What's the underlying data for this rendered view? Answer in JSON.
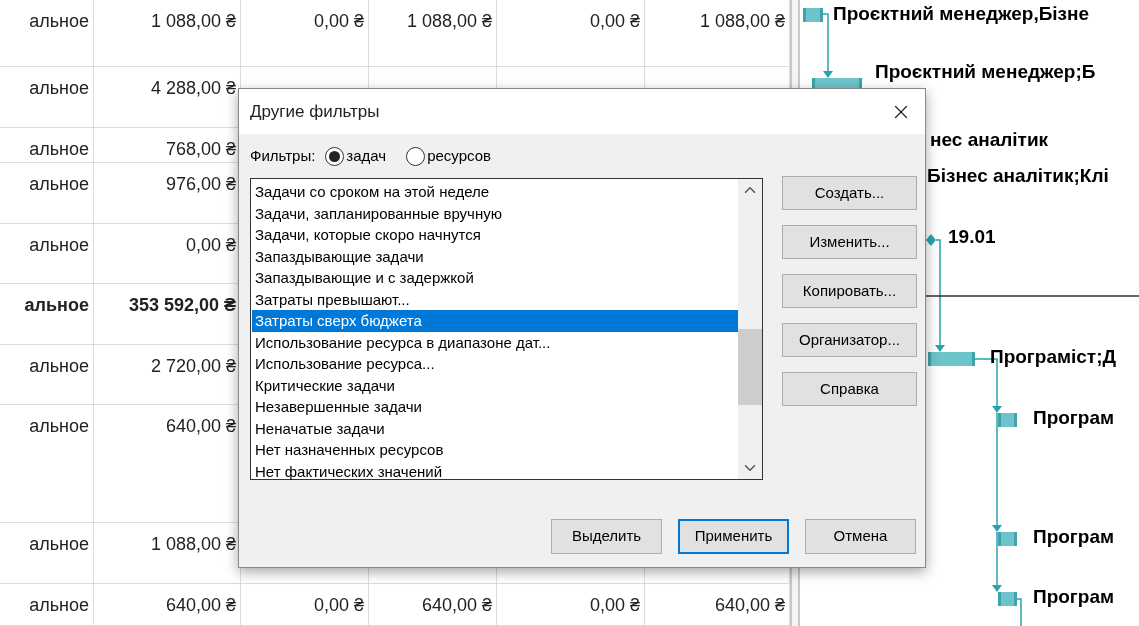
{
  "table": {
    "rows": [
      {
        "bold": false,
        "cells": [
          "альное",
          "1 088,00 ₴",
          "0,00 ₴",
          "1 088,00 ₴",
          "0,00 ₴",
          "1 088,00 ₴"
        ]
      },
      {
        "bold": false,
        "cells": [
          "альное",
          "4 288,00 ₴"
        ]
      },
      {
        "bold": false,
        "cells": [
          "альное",
          "768,00 ₴"
        ]
      },
      {
        "bold": false,
        "cells": [
          "альное",
          "976,00 ₴"
        ]
      },
      {
        "bold": false,
        "cells": [
          "альное",
          "0,00 ₴"
        ]
      },
      {
        "bold": true,
        "cells": [
          "альное",
          "353 592,00 ₴"
        ]
      },
      {
        "bold": false,
        "cells": [
          "альное",
          "2 720,00 ₴"
        ]
      },
      {
        "bold": false,
        "cells": [
          "альное",
          "640,00 ₴"
        ]
      },
      {
        "bold": false,
        "cells": [
          "альное",
          "1 088,00 ₴"
        ]
      },
      {
        "bold": false,
        "cells": [
          "альное",
          "640,00 ₴",
          "0,00 ₴",
          "640,00 ₴",
          "0,00 ₴",
          "640,00 ₴"
        ]
      }
    ]
  },
  "gantt": {
    "labels": [
      "Проєктний менеджер,Бізне",
      "Проєктний менеджер;Б",
      "нес аналітик",
      "Бізнес аналітик;Клі",
      "19.01",
      "Програміст;Д",
      "Програм",
      "Програм",
      "Програм"
    ]
  },
  "dialog": {
    "title": "Другие фильтры",
    "filter_label": "Фильтры:",
    "filter_types": [
      {
        "label": "задач",
        "selected": true
      },
      {
        "label": "ресурсов",
        "selected": false
      }
    ],
    "filters": [
      {
        "label": "Задачи со сроком на этой неделе",
        "selected": false
      },
      {
        "label": "Задачи, запланированные вручную",
        "selected": false
      },
      {
        "label": "Задачи, которые скоро начнутся",
        "selected": false
      },
      {
        "label": "Запаздывающие задачи",
        "selected": false
      },
      {
        "label": "Запаздывающие и с задержкой",
        "selected": false
      },
      {
        "label": "Затраты превышают...",
        "selected": false
      },
      {
        "label": "Затраты сверх бюджета",
        "selected": true
      },
      {
        "label": "Использование ресурса в диапазоне дат...",
        "selected": false
      },
      {
        "label": "Использование ресурса...",
        "selected": false
      },
      {
        "label": "Критические задачи",
        "selected": false
      },
      {
        "label": "Незавершенные задачи",
        "selected": false
      },
      {
        "label": "Неначатые задачи",
        "selected": false
      },
      {
        "label": "Нет назначенных ресурсов",
        "selected": false
      },
      {
        "label": "Нет фактических значений",
        "selected": false
      }
    ],
    "side_buttons": [
      "Создать...",
      "Изменить...",
      "Копировать...",
      "Организатор...",
      "Справка"
    ],
    "bottom_buttons": [
      {
        "label": "Выделить",
        "default": false
      },
      {
        "label": "Применить",
        "default": true
      },
      {
        "label": "Отмена",
        "default": false
      }
    ]
  }
}
